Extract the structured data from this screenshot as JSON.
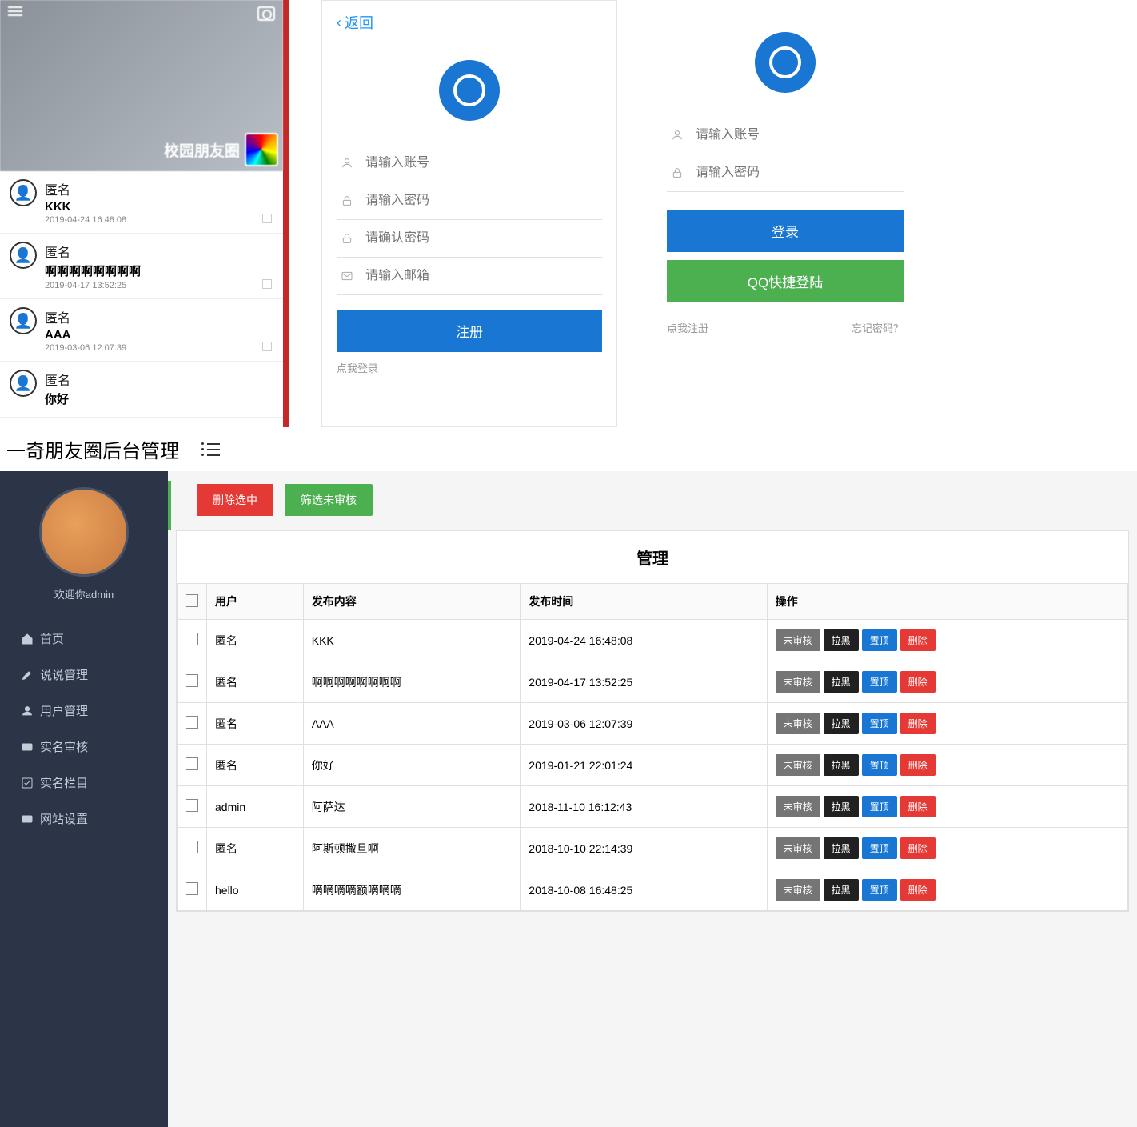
{
  "feed": {
    "title": "校园朋友圈",
    "items": [
      {
        "anon": "匿名",
        "content": "KKK",
        "time": "2019-04-24 16:48:08"
      },
      {
        "anon": "匿名",
        "content": "啊啊啊啊啊啊啊啊",
        "time": "2019-04-17 13:52:25"
      },
      {
        "anon": "匿名",
        "content": "AAA",
        "time": "2019-03-06 12:07:39"
      },
      {
        "anon": "匿名",
        "content": "你好",
        "time": ""
      }
    ]
  },
  "register": {
    "back": "返回",
    "account_ph": "请输入账号",
    "password_ph": "请输入密码",
    "confirm_ph": "请确认密码",
    "email_ph": "请输入邮箱",
    "submit": "注册",
    "login_link": "点我登录"
  },
  "login": {
    "account_ph": "请输入账号",
    "password_ph": "请输入密码",
    "login_btn": "登录",
    "qq_btn": "QQ快捷登陆",
    "register_link": "点我注册",
    "forgot_link": "忘记密码？"
  },
  "admin": {
    "title": "一奇朋友圈后台管理",
    "welcome": "欢迎你admin",
    "nav": [
      {
        "label": "首页",
        "icon": "home"
      },
      {
        "label": "说说管理",
        "icon": "edit"
      },
      {
        "label": "用户管理",
        "icon": "user"
      },
      {
        "label": "实名审核",
        "icon": "card"
      },
      {
        "label": "实名栏目",
        "icon": "check"
      },
      {
        "label": "网站设置",
        "icon": "card"
      }
    ],
    "actions": {
      "delete_selected": "删除选中",
      "filter_unaudited": "筛选未审核"
    },
    "table": {
      "title": "管理",
      "headers": {
        "user": "用户",
        "content": "发布内容",
        "time": "发布时间",
        "ops": "操作"
      },
      "op_labels": {
        "unaudit": "未审核",
        "black": "拉黑",
        "top": "置顶",
        "delete": "删除"
      },
      "rows": [
        {
          "user": "匿名",
          "content": "KKK",
          "time": "2019-04-24 16:48:08"
        },
        {
          "user": "匿名",
          "content": "啊啊啊啊啊啊啊啊",
          "time": "2019-04-17 13:52:25"
        },
        {
          "user": "匿名",
          "content": "AAA",
          "time": "2019-03-06 12:07:39"
        },
        {
          "user": "匿名",
          "content": "你好",
          "time": "2019-01-21 22:01:24"
        },
        {
          "user": "admin",
          "content": "阿萨达",
          "time": "2018-11-10 16:12:43"
        },
        {
          "user": "匿名",
          "content": "阿斯顿撒旦啊",
          "time": "2018-10-10 22:14:39"
        },
        {
          "user": "hello",
          "content": "嘀嘀嘀嘀额嘀嘀嘀",
          "time": "2018-10-08 16:48:25"
        }
      ]
    }
  }
}
